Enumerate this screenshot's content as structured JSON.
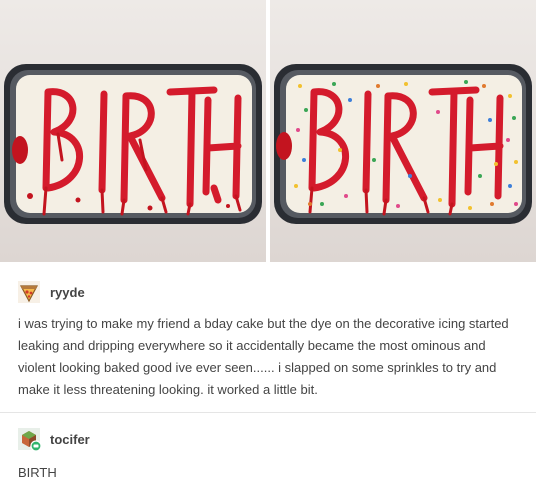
{
  "photos": {
    "left_cake_text": "BIRTH",
    "right_cake_text": "BIRTH"
  },
  "posts": [
    {
      "username": "ryyde",
      "avatar_icon": "pizza-avatar-icon",
      "text": "i was trying to make my friend a bday cake but the dye on the decorative icing started leaking and dripping everywhere so it accidentally became the most ominous and violent looking baked good ive ever seen...... i slapped on some sprinkles to try and make it less threatening looking. it worked a little bit."
    },
    {
      "username": "tocifer",
      "avatar_icon": "cube-avatar-icon",
      "text": "BIRTH"
    }
  ],
  "colors": {
    "icing": "#d41b2c",
    "frosting": "#f4efe4",
    "pan": "#2a2d33",
    "wall": "#ece7e4",
    "text": "#444444"
  }
}
